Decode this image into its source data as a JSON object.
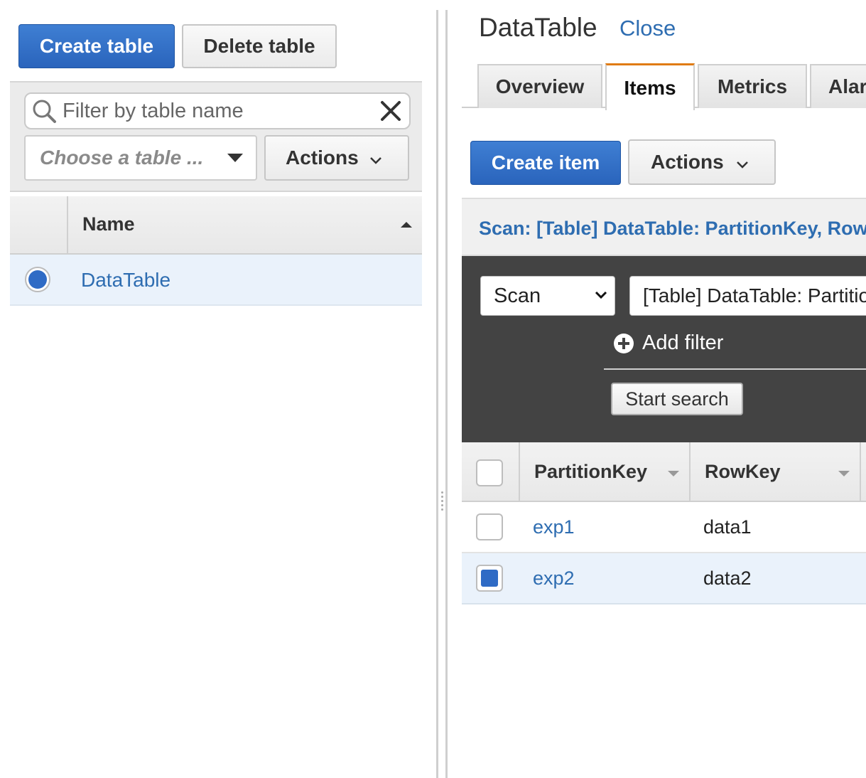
{
  "left": {
    "create_table_label": "Create table",
    "delete_table_label": "Delete table",
    "filter": {
      "placeholder": "Filter by table name",
      "value": ""
    },
    "table_select": {
      "placeholder": "Choose a table ..."
    },
    "actions_label": "Actions",
    "table": {
      "column_name": "Name",
      "rows": [
        {
          "name": "DataTable",
          "selected": true
        }
      ]
    }
  },
  "right": {
    "title": "DataTable",
    "close_label": "Close",
    "tabs": [
      {
        "label": "Overview",
        "active": false
      },
      {
        "label": "Items",
        "active": true
      },
      {
        "label": "Metrics",
        "active": false
      },
      {
        "label": "Alarms",
        "active": false
      }
    ],
    "create_item_label": "Create item",
    "actions_label": "Actions",
    "scan_header": "Scan: [Table] DataTable: PartitionKey, RowKey",
    "scan_mode": "Scan",
    "scan_target": "[Table] DataTable: PartitionKey, RowKey",
    "add_filter_label": "Add filter",
    "start_search_label": "Start search",
    "items": {
      "columns": [
        "PartitionKey",
        "RowKey"
      ],
      "rows": [
        {
          "partition_key": "exp1",
          "row_key": "data1",
          "checked": false
        },
        {
          "partition_key": "exp2",
          "row_key": "data2",
          "checked": true
        }
      ]
    }
  },
  "colors": {
    "primary": "#2e6db1",
    "active_tab": "#e07b12",
    "dark_panel": "#434343",
    "selected_row": "#eaf2fb"
  }
}
